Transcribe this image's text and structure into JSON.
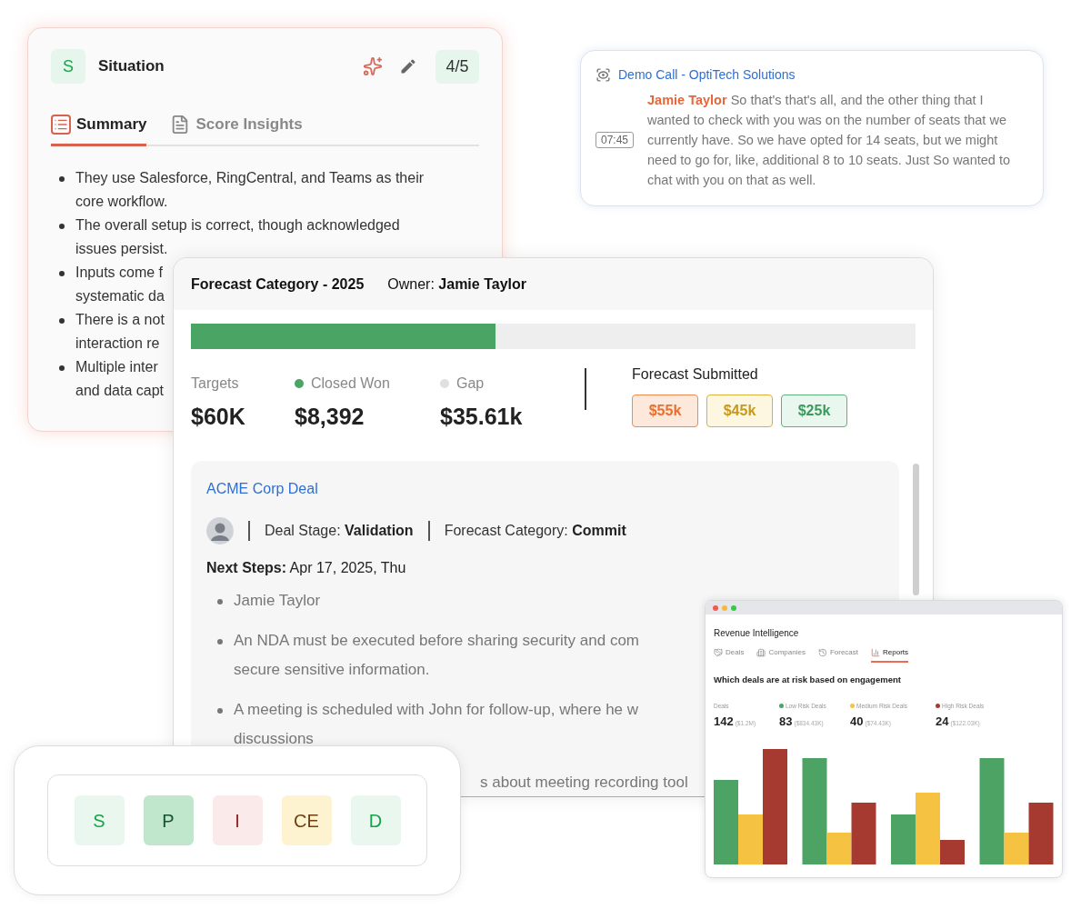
{
  "summary_card": {
    "badge": "S",
    "title": "Situation",
    "score": "4/5",
    "tabs": [
      {
        "label": "Summary",
        "selected": true
      },
      {
        "label": "Score Insights",
        "selected": false
      }
    ],
    "bullets": [
      {
        "lines": [
          "They use Salesforce, RingCentral, and Teams as their",
          "core workflow."
        ]
      },
      {
        "lines": [
          "The overall setup is correct, though acknowledged",
          "issues persist."
        ]
      },
      {
        "lines": [
          "Inputs come f",
          "systematic da"
        ]
      },
      {
        "lines": [
          "There is a not",
          "interaction re"
        ]
      },
      {
        "lines": [
          "Multiple inter",
          "and data capt"
        ]
      }
    ]
  },
  "call_card": {
    "title": "Demo Call - OptiTech Solutions",
    "timestamp": "07:45",
    "speaker": "Jamie Taylor",
    "text": "So that's that's all, and the other thing that I wanted to check with you was on the number of seats that we currently have. So we have opted for 14 seats, but we might need to go for, like, additional 8 to 10 seats. Just So wanted to chat with you on that as well."
  },
  "forecast_card": {
    "title": "Forecast Category - 2025",
    "owner_label": "Owner:",
    "owner": "Jamie Taylor",
    "progress": {
      "level": 0.42
    },
    "stats": [
      {
        "label": "Targets",
        "value": "$60K"
      },
      {
        "label": "Closed Won",
        "value": "$8,392",
        "color": "#4aa564"
      },
      {
        "label": "Gap",
        "value": "$35.61k",
        "color": "#e0e0e0"
      }
    ],
    "submitted_label": "Forecast Submitted",
    "submitted": [
      {
        "value": "$55k",
        "kind": "orange"
      },
      {
        "value": "$45k",
        "kind": "yellow"
      },
      {
        "value": "$25k",
        "kind": "green"
      }
    ],
    "deal": {
      "name": "ACME Corp Deal",
      "stage_label": "Deal Stage:",
      "stage": "Validation",
      "category_label": "Forecast Category:",
      "category": "Commit",
      "next_label": "Next Steps:",
      "next_date": "Apr 17, 2025, Thu",
      "steps": [
        {
          "lines": [
            "Jamie Taylor"
          ]
        },
        {
          "lines": [
            "An NDA must be executed before sharing security and com",
            "secure sensitive information."
          ]
        },
        {
          "lines": [
            "A meeting is scheduled with John for follow-up, where he w",
            "discussions"
          ]
        }
      ],
      "cut_line": "s about meeting recording tool"
    }
  },
  "spiced": [
    {
      "letter": "S",
      "kind": "good"
    },
    {
      "letter": "P",
      "kind": "strong"
    },
    {
      "letter": "I",
      "kind": "risk"
    },
    {
      "letter": "CE",
      "kind": "partial"
    },
    {
      "letter": "D",
      "kind": "good"
    }
  ],
  "report_window": {
    "title": "Revenue Intelligence",
    "tabs": [
      {
        "label": "Deals",
        "selected": false
      },
      {
        "label": "Companies",
        "selected": false
      },
      {
        "label": "Forecast",
        "selected": false
      },
      {
        "label": "Reports",
        "selected": true
      }
    ],
    "heading": "Which deals are at risk based on engagement",
    "stats": [
      {
        "label": "Deals",
        "value": "142",
        "amount": "($1.2M)"
      },
      {
        "label": "Low Risk Deals",
        "value": "83",
        "amount": "($834.43K)",
        "color": "#4ca364"
      },
      {
        "label": "Medium Risk Deals",
        "value": "40",
        "amount": "($74.43K)",
        "color": "#f5c242"
      },
      {
        "label": "High Risk Deals",
        "value": "24",
        "amount": "($122.03K)",
        "color": "#a63a30"
      }
    ]
  }
}
